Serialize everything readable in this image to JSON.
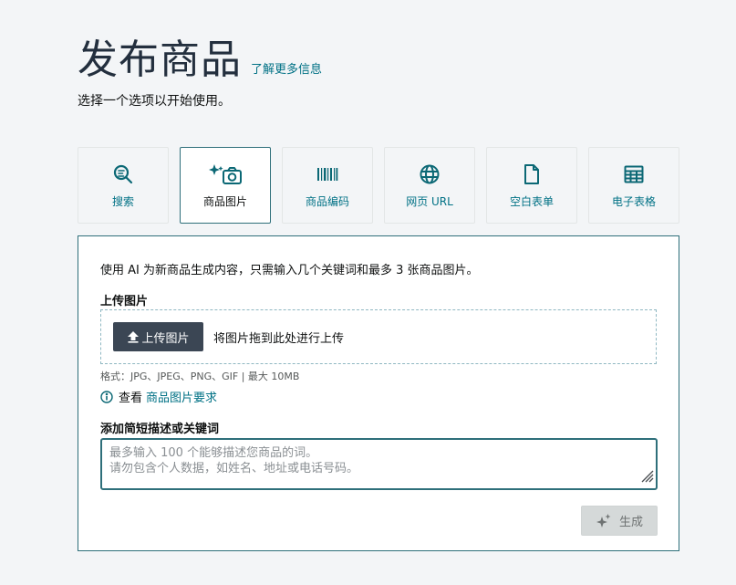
{
  "header": {
    "title": "发布商品",
    "learn_more": "了解更多信息",
    "subtitle": "选择一个选项以开始使用。"
  },
  "tabs": [
    {
      "label": "搜索",
      "icon": "search-icon"
    },
    {
      "label": "商品图片",
      "icon": "camera-sparkle-icon",
      "active": true
    },
    {
      "label": "商品编码",
      "icon": "barcode-icon"
    },
    {
      "label": "网页 URL",
      "icon": "globe-icon"
    },
    {
      "label": "空白表单",
      "icon": "document-icon"
    },
    {
      "label": "电子表格",
      "icon": "spreadsheet-icon"
    }
  ],
  "panel": {
    "intro": "使用 AI 为新商品生成内容，只需输入几个关键词和最多 3 张商品图片。",
    "upload_heading": "上传图片",
    "upload_button": "上传图片",
    "drop_text": "将图片拖到此处进行上传",
    "formats": "格式：JPG、JPEG、PNG、GIF | 最大 10MB",
    "view_text": "查看",
    "requirements_link": "商品图片要求",
    "desc_heading": "添加简短描述或关键词",
    "desc_placeholder": "最多输入 100 个能够描述您商品的词。\n请勿包含个人数据，如姓名、地址或电话号码。",
    "desc_value": "",
    "generate_button": "生成"
  },
  "colors": {
    "accent": "#2e6f7a",
    "link": "#007185",
    "dark_button": "#3b4654",
    "disabled_button": "#d5d9d9"
  }
}
